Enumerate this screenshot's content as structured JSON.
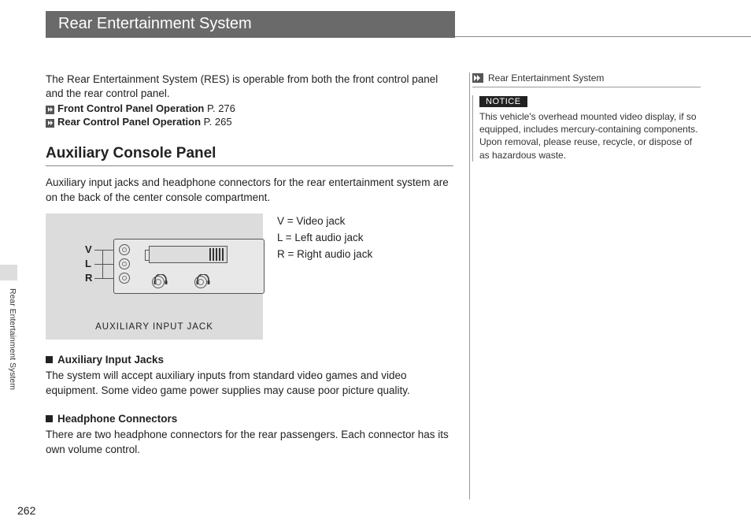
{
  "header": {
    "title": "Rear Entertainment System"
  },
  "intro": "The Rear Entertainment System (RES) is operable from both the front control panel and the rear control panel.",
  "refs": [
    {
      "label": "Front Control Panel Operation",
      "page": "P. 276"
    },
    {
      "label": "Rear Control Panel Operation",
      "page": "P. 265"
    }
  ],
  "section": {
    "heading": "Auxiliary Console Panel",
    "para": "Auxiliary input jacks and headphone connectors for the rear entertainment system are on the back of the center console compartment."
  },
  "diagram": {
    "labels": {
      "v": "V",
      "l": "L",
      "r": "R"
    },
    "caption": "AUXILIARY INPUT JACK"
  },
  "legend": {
    "v": "V = Video jack",
    "l": "L = Left audio jack",
    "r": "R = Right audio jack"
  },
  "sub1": {
    "head": "Auxiliary Input Jacks",
    "text": "The system will accept auxiliary inputs from standard video games and video equipment. Some video game power supplies may cause poor picture quality."
  },
  "sub2": {
    "head": "Headphone Connectors",
    "text": "There are two headphone connectors for the rear passengers. Each connector has its own volume control."
  },
  "sidebar": {
    "head": "Rear Entertainment System",
    "noticeLabel": "NOTICE",
    "noticeText": "This vehicle's overhead mounted video display, if so equipped, includes mercury-containing components. Upon removal, please reuse, recycle, or dispose of as hazardous waste."
  },
  "tab": "Rear Entertainment System",
  "pageNumber": "262"
}
